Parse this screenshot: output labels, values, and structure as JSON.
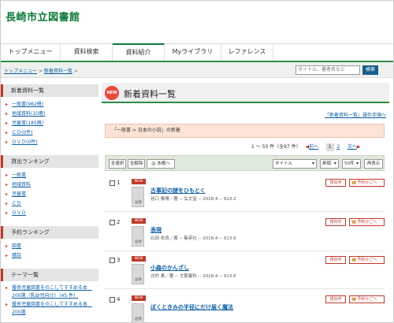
{
  "site_title": "長崎市立図書館",
  "tabs": [
    {
      "label": "トップメニュー"
    },
    {
      "label": "資料検索"
    },
    {
      "label": "資料紹介"
    },
    {
      "label": "Myライブラリ"
    },
    {
      "label": "レファレンス"
    }
  ],
  "breadcrumb": {
    "home": "トップメニュー",
    "current": "新着資料一覧",
    "sep": ">"
  },
  "search": {
    "placeholder": "タイトル、著者名など",
    "button": "検索"
  },
  "sidebar": {
    "new_heading": "新着資料一覧",
    "new_items": [
      {
        "label": "一般書(962冊)"
      },
      {
        "label": "地域資料(10冊)"
      },
      {
        "label": "児童書(185冊)"
      },
      {
        "label": "ＣＤ(0件)"
      },
      {
        "label": "ＤＶＤ(0件)"
      }
    ],
    "loan_heading": "貸出ランキング",
    "loan_items": [
      {
        "label": "一般書"
      },
      {
        "label": "地域資料"
      },
      {
        "label": "児童書"
      },
      {
        "label": "ＣＤ"
      },
      {
        "label": "ＤＶＤ"
      }
    ],
    "reserve_heading": "予約ランキング",
    "reserve_items": [
      {
        "label": "図書"
      },
      {
        "label": "雑誌"
      }
    ],
    "theme_heading": "テーマ一覧",
    "theme_items": [
      {
        "label": "優良児童図書をのこしてすすめる本　200選（乳幼児向け）（45 件）"
      },
      {
        "label": "優良児童図書をのこしてすすめる本　200選"
      }
    ]
  },
  "main": {
    "new_badge": "NEW",
    "title": "新着資料一覧",
    "help_link": "「新着資料一覧」操作手順へ",
    "condition": "「一般書 > 日本の小説」の新着",
    "pager": {
      "range": "1 〜 50 件（全97 件）",
      "prev": "前へ",
      "page1": "1",
      "page2": "2",
      "next": "次へ"
    },
    "toolbar": {
      "select_all": "全選択",
      "clear_all": "全解除",
      "bookshelf": "本棚へ",
      "sort": "タイトル",
      "order": "昇順",
      "count": "50件",
      "redisplay": "再表示"
    },
    "entry_badge": "NEW",
    "thumb_label": "画像",
    "status_label": "貸出中",
    "reserve_label": "予約かごへ",
    "entries": [
      {
        "num": "1",
        "title": "古事記の謎をひもとく",
        "meta": "谷口 雅博／著 -- 弘文堂 -- 2018.4 -- 913.2"
      },
      {
        "num": "2",
        "title": "表現",
        "meta": "石田 衣良／著 -- 集英社 -- 2018.4 -- 913.6"
      },
      {
        "num": "3",
        "title": "小森のかんざし",
        "meta": "北村 薫／著 -- 文藝春秋 -- 2018.4 -- 913.6"
      },
      {
        "num": "4",
        "title": "ぼくときみの半径にだけ届く魔法",
        "meta": ""
      }
    ]
  }
}
